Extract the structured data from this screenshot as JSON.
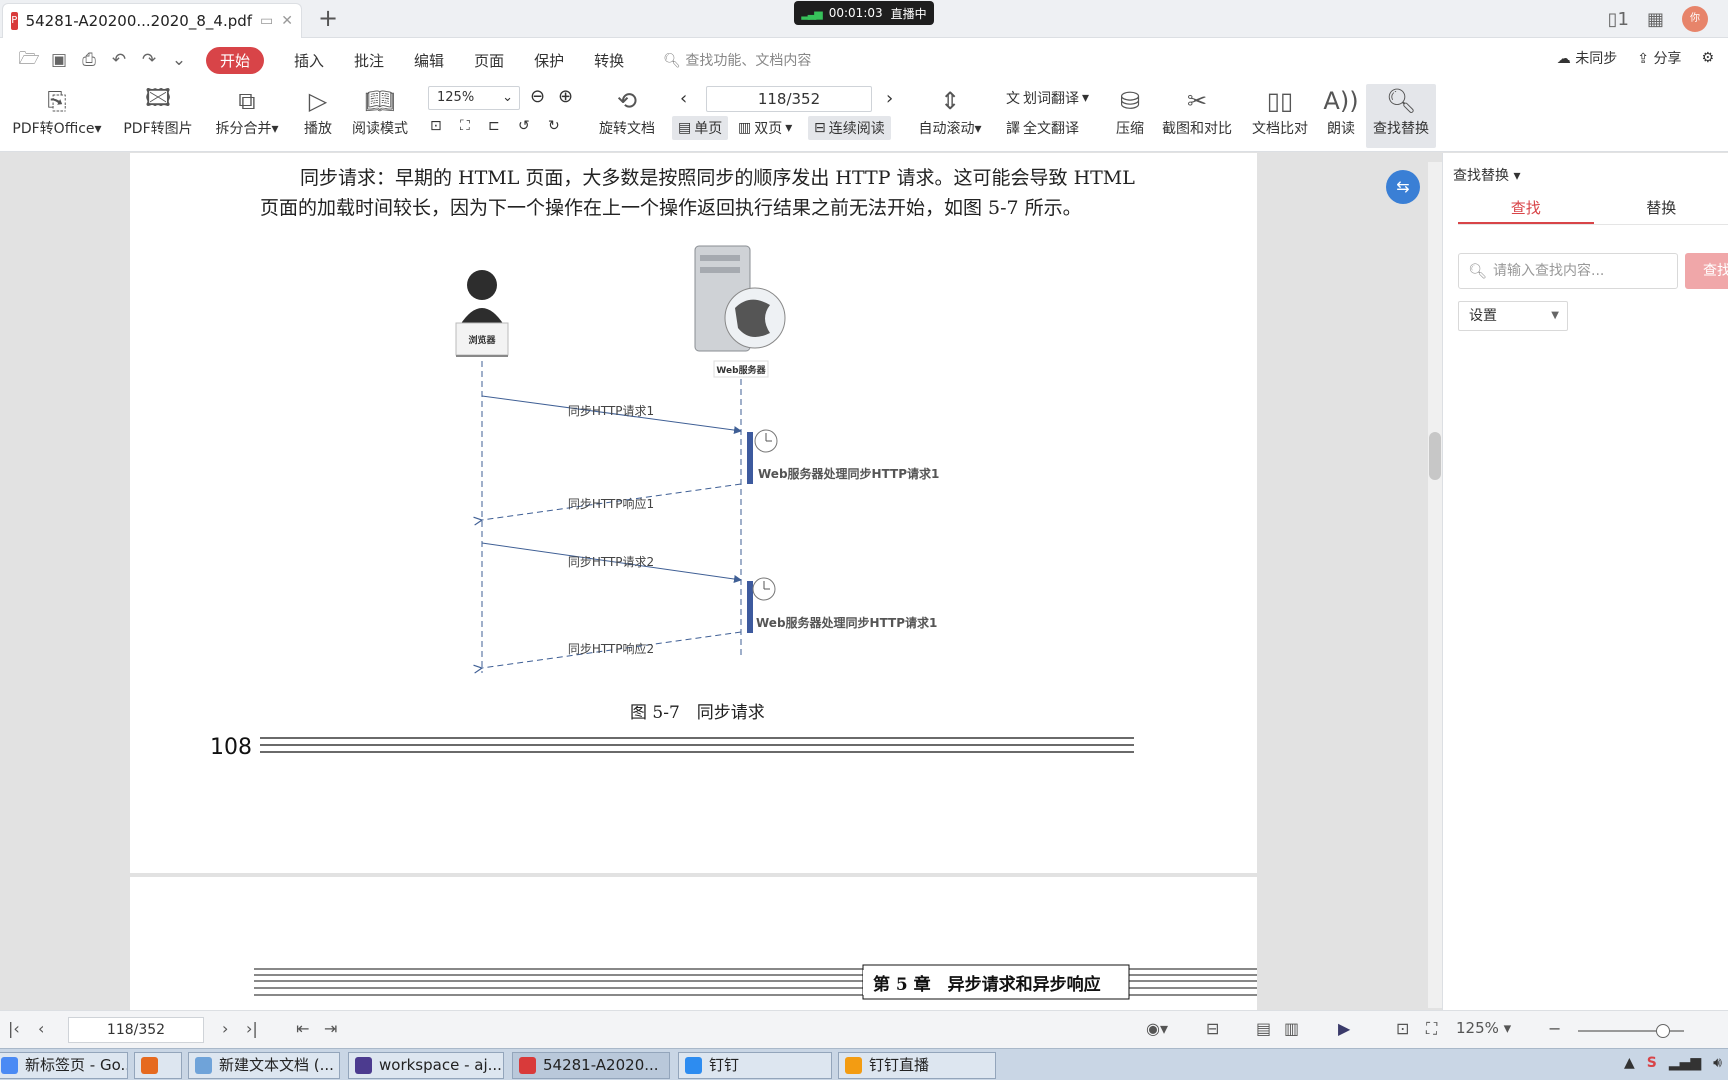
{
  "tab": {
    "title": "54281-A20200...2020_8_4.pdf"
  },
  "recording": {
    "time": "00:01:03",
    "status": "直播中"
  },
  "menu": {
    "items": [
      "开始",
      "插入",
      "批注",
      "编辑",
      "页面",
      "保护",
      "转换"
    ],
    "search_placeholder": "查找功能、文档内容",
    "sync": "未同步",
    "share": "分享"
  },
  "ribbon": {
    "pdf_to_office": "PDF转Office",
    "pdf_to_image": "PDF转图片",
    "split_merge": "拆分合并",
    "play": "播放",
    "read_mode": "阅读模式",
    "zoom": "125%",
    "rotate": "旋转文档",
    "page": "118/352",
    "single": "单页",
    "double": "双页",
    "continuous": "连续阅读",
    "auto_scroll": "自动滚动",
    "word_translate": "划词翻译",
    "full_translate": "全文翻译",
    "compress": "压缩",
    "screenshot_compare": "截图和对比",
    "doc_compare": "文档比对",
    "read_aloud": "朗读",
    "find_replace": "查找替换"
  },
  "document": {
    "para_line1": "同步请求：早期的 HTML 页面，大多数是按照同步的顺序发出 HTTP 请求。这可能会导致 HTML",
    "para_line2": "页面的加载时间较长，因为下一个操作在上一个操作返回执行结果之前无法开始，如图 5-7 所示。",
    "browser_label": "浏览器",
    "server_label": "Web服务器",
    "req1": "同步HTTP请求1",
    "resp1": "同步HTTP响应1",
    "req2": "同步HTTP请求2",
    "resp2": "同步HTTP响应2",
    "proc1": "Web服务器处理同步HTTP请求1",
    "proc2": "Web服务器处理同步HTTP请求1",
    "caption": "图 5-7　同步请求",
    "page_number": "108",
    "next_header": "第 5 章　异步请求和异步响应"
  },
  "panel": {
    "title": "查找替换",
    "tab_find": "查找",
    "tab_replace": "替换",
    "input_placeholder": "请输入查找内容...",
    "find_button": "查找",
    "settings": "设置"
  },
  "statusbar": {
    "page": "118/352",
    "zoom": "125%"
  },
  "taskbar": [
    {
      "label": "新标签页 - Go...",
      "color": "#4a8af4"
    },
    {
      "label": "",
      "color": "#e66a1f"
    },
    {
      "label": "新建文本文档 (...",
      "color": "#6fa3d9"
    },
    {
      "label": "workspace - aj...",
      "color": "#4c3b8f"
    },
    {
      "label": "54281-A2020...",
      "color": "#d93a3a"
    },
    {
      "label": "钉钉",
      "color": "#2d8cf0"
    },
    {
      "label": "钉钉直播",
      "color": "#f39c12"
    }
  ],
  "colors": {
    "accent": "#d84448",
    "lifeline": "#3f5f95",
    "activation": "#3d5a9e"
  }
}
